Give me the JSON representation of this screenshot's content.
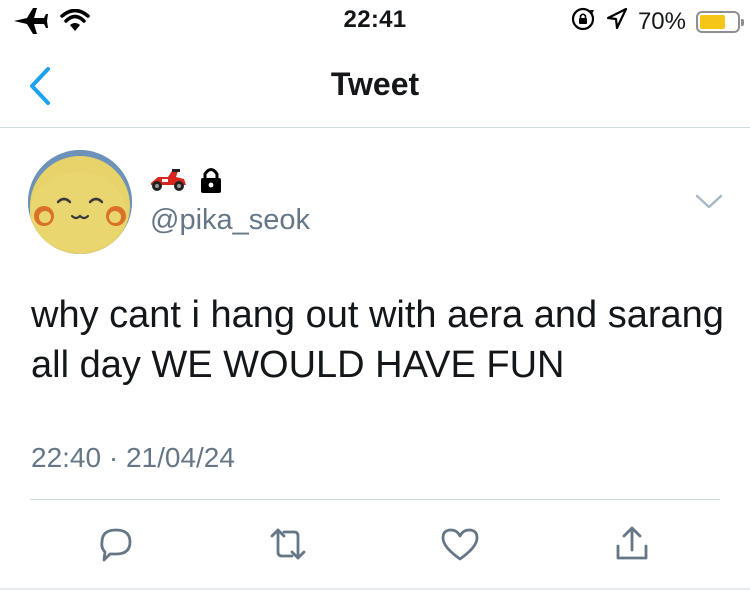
{
  "status_bar": {
    "time": "22:41",
    "battery_percent_label": "70%",
    "battery_level": 0.7,
    "icons": [
      "airplane-icon",
      "wifi-icon",
      "rotation-lock-icon",
      "location-arrow-icon",
      "battery-icon"
    ],
    "battery_color": "#f5c518"
  },
  "nav": {
    "title": "Tweet",
    "back_icon": "chevron-left-icon",
    "accent_color": "#1da1f2"
  },
  "tweet": {
    "display_name_icons": [
      "race-car-emoji",
      "lock-icon"
    ],
    "handle": "@pika_seok",
    "text": "why cant i hang out with aera and sarang all day WE WOULD HAVE FUN",
    "timestamp": "22:40 · 21/04/24"
  },
  "actions": [
    "reply-icon",
    "retweet-icon",
    "like-icon",
    "share-icon"
  ]
}
